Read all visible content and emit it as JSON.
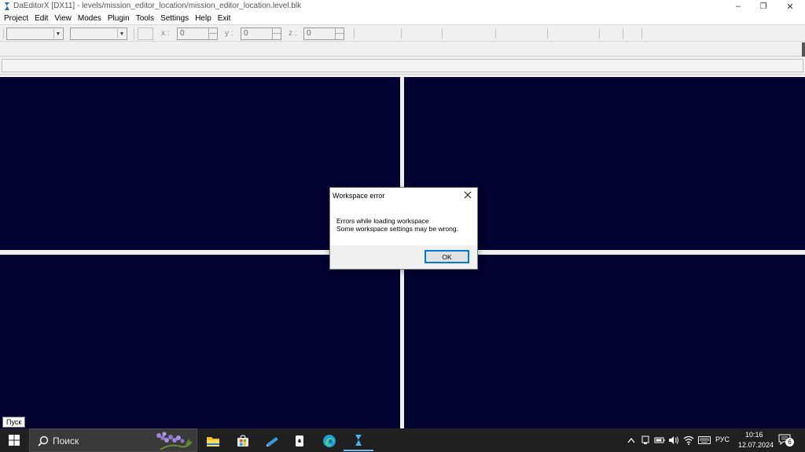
{
  "window": {
    "title": "DaEditorX  [DX11]  - levels/mission_editor_location/mission_editor_location.level.blk",
    "minimize": "–",
    "maximize": "❐",
    "close": "✕"
  },
  "menu": [
    "Project",
    "Edit",
    "View",
    "Modes",
    "Plugin",
    "Tools",
    "Settings",
    "Help",
    "Exit"
  ],
  "toolbar": {
    "x_label": "x :",
    "y_label": "y :",
    "z_label": "z :",
    "x_value": "0",
    "y_value": "0",
    "z_value": "0"
  },
  "dialog": {
    "title": "Workspace error",
    "line1": "Errors while loading workspace",
    "line2": "Some workspace settings may be wrong.",
    "ok_label": "OK"
  },
  "tooltip": "Пуск",
  "taskbar": {
    "search_placeholder": "Поиск",
    "language": "РУС",
    "time": "10:16",
    "date": "12.07.2024",
    "notification_count": "6"
  },
  "colors": {
    "viewport_bg": "#030332",
    "taskbar_bg": "#202020",
    "accent": "#0078d7"
  }
}
